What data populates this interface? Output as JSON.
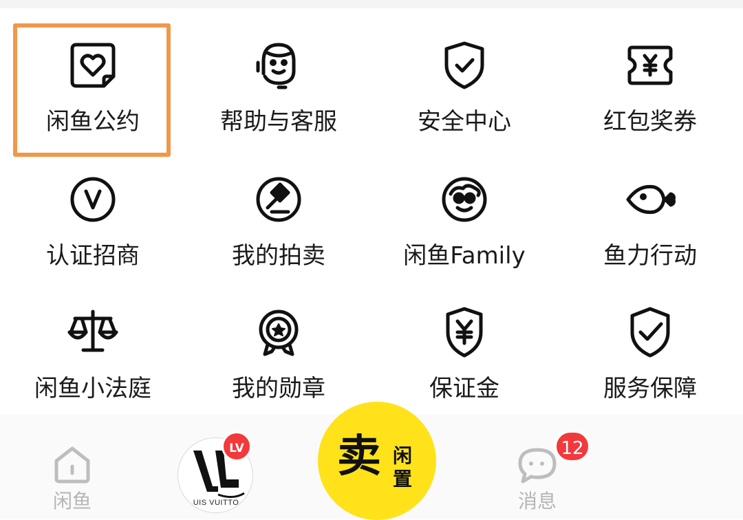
{
  "services": [
    {
      "label": "闲鱼公约",
      "icon": "heart-card-icon",
      "highlighted": true
    },
    {
      "label": "帮助与客服",
      "icon": "customer-service-headset-icon"
    },
    {
      "label": "安全中心",
      "icon": "shield-check-icon"
    },
    {
      "label": "红包奖券",
      "icon": "yuan-coupon-icon"
    },
    {
      "label": "认证招商",
      "icon": "v-verified-icon"
    },
    {
      "label": "我的拍卖",
      "icon": "auction-gavel-icon"
    },
    {
      "label": "闲鱼Family",
      "icon": "monkey-face-icon"
    },
    {
      "label": "鱼力行动",
      "icon": "heart-fish-icon"
    },
    {
      "label": "闲鱼小法庭",
      "icon": "scales-icon"
    },
    {
      "label": "我的勋章",
      "icon": "star-medal-icon"
    },
    {
      "label": "保证金",
      "icon": "yuan-shield-icon"
    },
    {
      "label": "服务保障",
      "icon": "shield-checkmark-icon"
    }
  ],
  "highlight_color": "#f0984a",
  "tabbar": {
    "home_label": "闲鱼",
    "avatar_badge": "LV",
    "avatar_text": "UIS VUITTO",
    "sell_main": "卖",
    "sell_sub": "闲置",
    "sell_color": "#ffe21a",
    "messages_label": "消息",
    "messages_badge": "12",
    "badge_color": "#f2393c"
  }
}
